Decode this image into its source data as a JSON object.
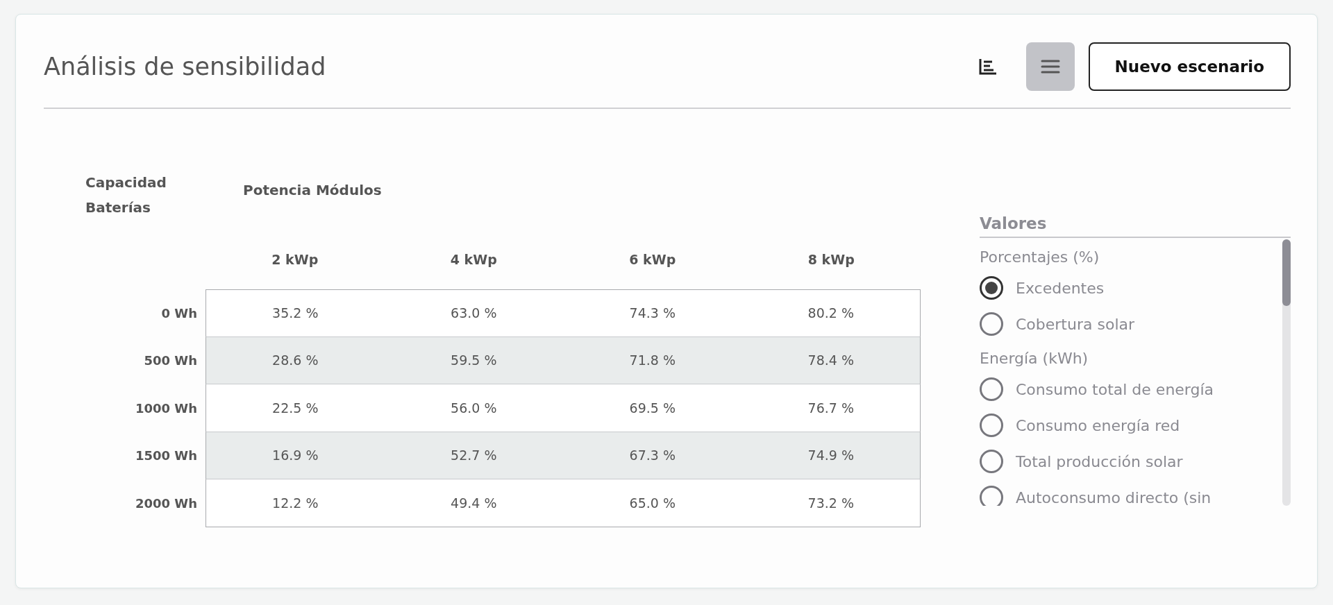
{
  "card": {
    "title": "Análisis de sensibilidad",
    "view_toggles": [
      {
        "kind": "chart",
        "selected": false
      },
      {
        "kind": "list",
        "selected": true
      }
    ],
    "new_button": "Nuevo escenario"
  },
  "table": {
    "row_header": "Capacidad Baterías",
    "column_header": "Potencia Módulos",
    "columns": [
      "2 kWp",
      "4 kWp",
      "6 kWp",
      "8 kWp"
    ],
    "rows": [
      {
        "label": "0 Wh",
        "cells": [
          "35.2 %",
          "63.0 %",
          "74.3 %",
          "80.2 %"
        ]
      },
      {
        "label": "500 Wh",
        "cells": [
          "28.6 %",
          "59.5 %",
          "71.8 %",
          "78.4 %"
        ]
      },
      {
        "label": "1000 Wh",
        "cells": [
          "22.5 %",
          "56.0 %",
          "69.5 %",
          "76.7 %"
        ]
      },
      {
        "label": "1500 Wh",
        "cells": [
          "16.9 %",
          "52.7 %",
          "67.3 %",
          "74.9 %"
        ]
      },
      {
        "label": "2000 Wh",
        "cells": [
          "12.2 %",
          "49.4 %",
          "65.0 %",
          "73.2 %"
        ]
      }
    ]
  },
  "values_panel": {
    "title": "Valores",
    "groups": [
      {
        "label": "Porcentajes (%)",
        "options": [
          {
            "label": "Excedentes",
            "selected": true
          },
          {
            "label": "Cobertura solar",
            "selected": false
          }
        ]
      },
      {
        "label": "Energía (kWh)",
        "options": [
          {
            "label": "Consumo total de energía",
            "selected": false
          },
          {
            "label": "Consumo energía red",
            "selected": false
          },
          {
            "label": "Total producción solar",
            "selected": false
          },
          {
            "label": "Autoconsumo directo (sin",
            "selected": false
          }
        ]
      }
    ]
  }
}
